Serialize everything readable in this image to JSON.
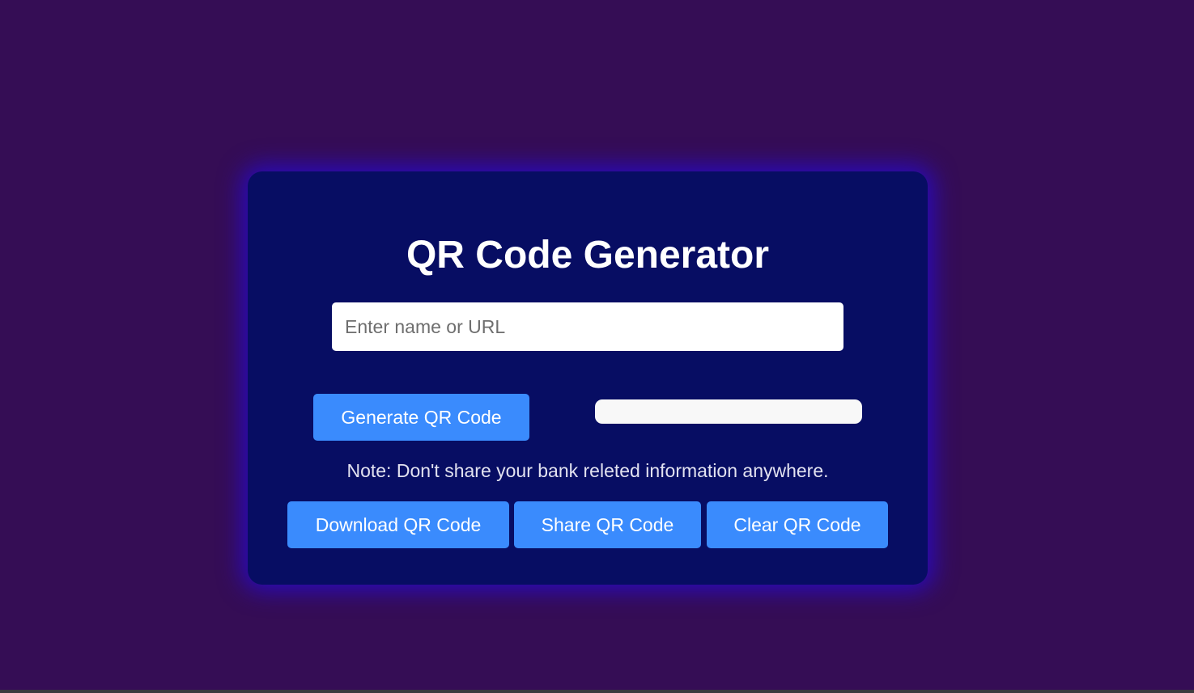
{
  "app": {
    "title": "QR Code Generator"
  },
  "input": {
    "placeholder": "Enter name or URL",
    "value": ""
  },
  "buttons": {
    "generate_label": "Generate QR Code",
    "download_label": "Download QR Code",
    "share_label": "Share QR Code",
    "clear_label": "Clear QR Code"
  },
  "note": {
    "text": "Note: Don't share your bank releted information anywhere."
  },
  "colors": {
    "page_background": "#350d55",
    "card_background": "#070d63",
    "card_glow": "#2a0ab8",
    "button_background": "#3a8bfd",
    "text_primary": "#ffffff"
  }
}
